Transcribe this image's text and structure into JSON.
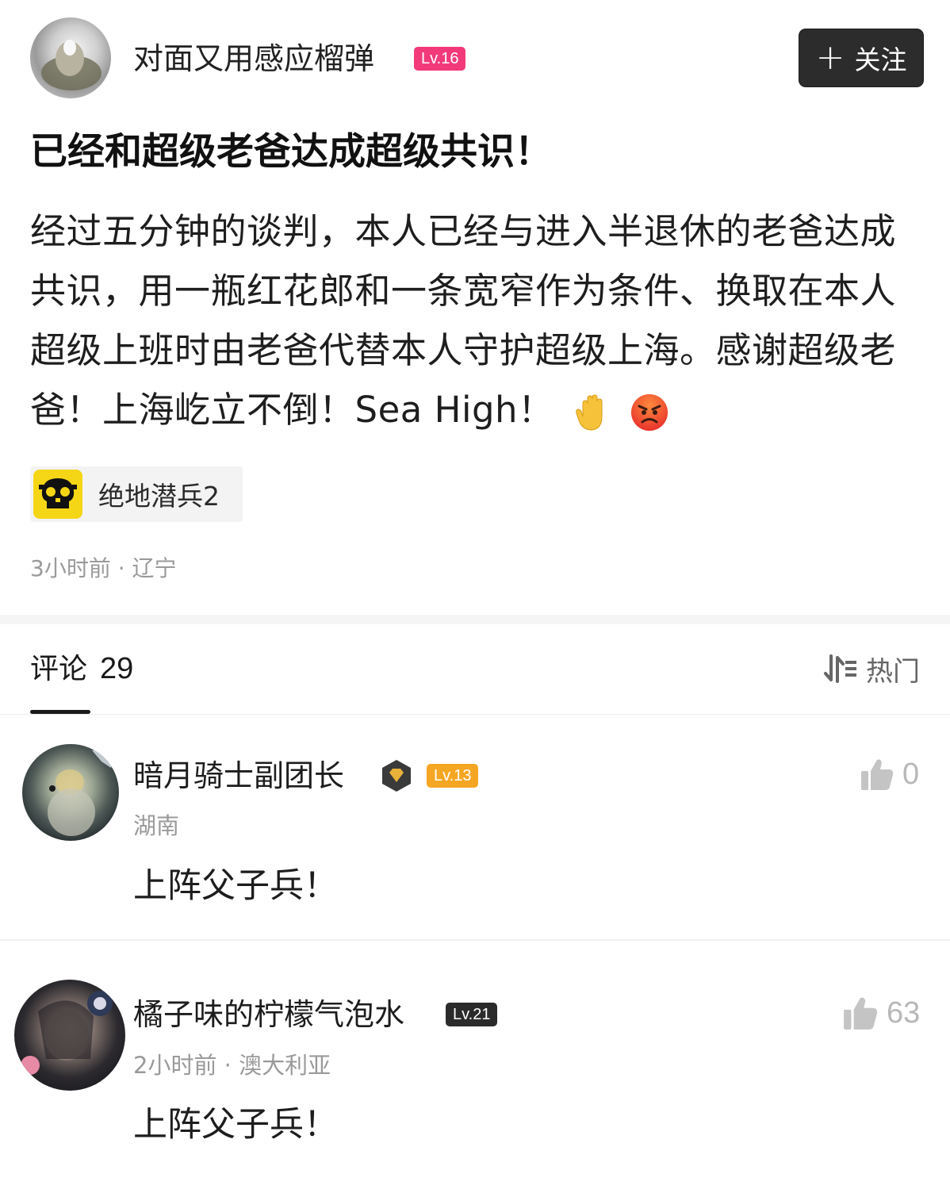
{
  "post": {
    "author": {
      "name": "对面又用感应榴弹",
      "level": "Lv.16"
    },
    "follow_label": "关注",
    "title": "已经和超级老爸达成超级共识！",
    "body": "经过五分钟的谈判，本人已经与进入半退休的老爸达成共识，用一瓶红花郎和一条宽窄作为条件、换取在本人超级上班时由老爸代替本人守护超级上海。感谢超级老爸！上海屹立不倒！Sea High！",
    "body_emojis": [
      "raised-hand-emoji",
      "angry-face-emoji"
    ],
    "topic": "绝地潜兵2",
    "meta": "3小时前 · 辽宁"
  },
  "comments_header": {
    "label": "评论",
    "count": "29",
    "sort_label": "热门"
  },
  "comments": [
    {
      "user": "暗月骑士副团长",
      "level": "Lv.13",
      "meta": "湖南",
      "text": "上阵父子兵！",
      "likes": "0"
    },
    {
      "user": "橘子味的柠檬气泡水",
      "level": "Lv.21",
      "meta": "2小时前 · 澳大利亚",
      "text": "上阵父子兵！",
      "likes": "63"
    }
  ],
  "colors": {
    "level_pink": "#f23a7a",
    "level_orange": "#f5a623",
    "level_dark": "#2b2b2b",
    "follow_bg": "#2c2c2c",
    "topic_icon_yellow": "#f5d616"
  }
}
